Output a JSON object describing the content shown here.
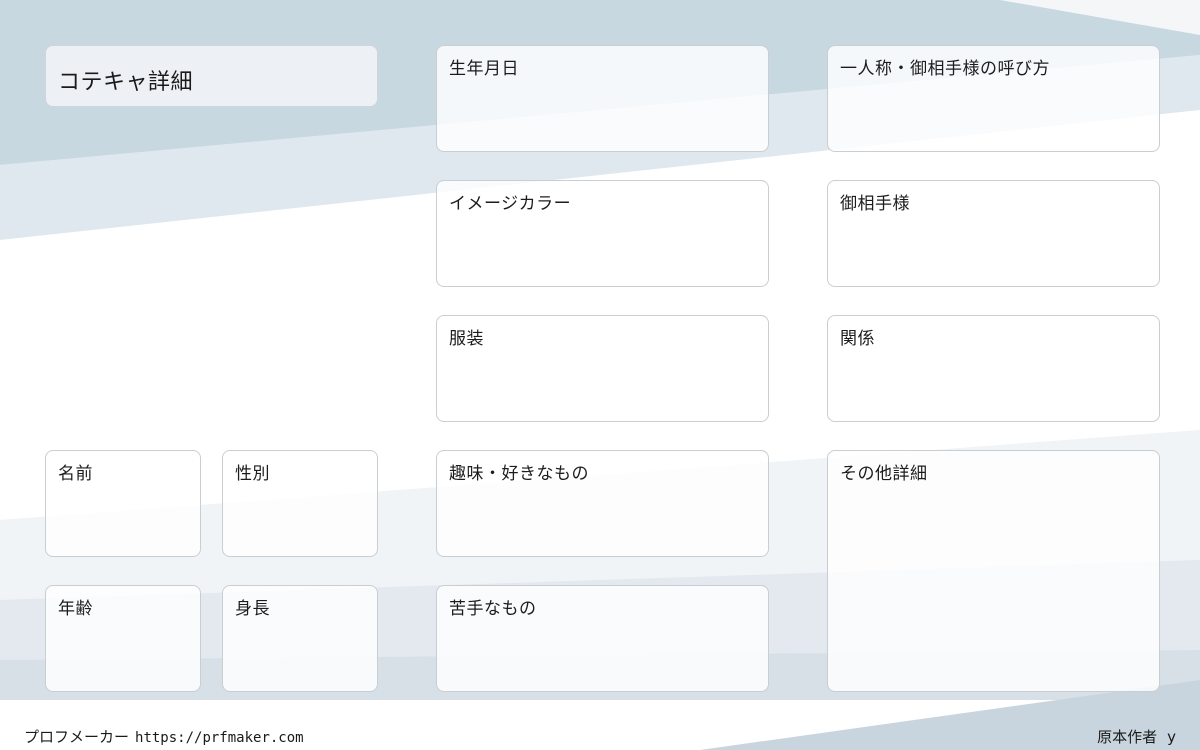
{
  "title": "コテキャ詳細",
  "fields": {
    "birthday": "生年月日",
    "pronouns": "一人称・御相手様の呼び方",
    "image_color": "イメージカラー",
    "partner": "御相手様",
    "outfit": "服装",
    "relationship": "関係",
    "name": "名前",
    "gender": "性別",
    "hobbies": "趣味・好きなもの",
    "other_details": "その他詳細",
    "age": "年齢",
    "height": "身長",
    "dislikes": "苦手なもの"
  },
  "footer": {
    "brand": "プロフメーカー",
    "url": "https://prfmaker.com",
    "author_label": "原本作者",
    "author_name": "y"
  },
  "colors": {
    "background_top": "#c7d7e0",
    "background_light": "#ffffff",
    "card_border": "#c9ced3"
  }
}
